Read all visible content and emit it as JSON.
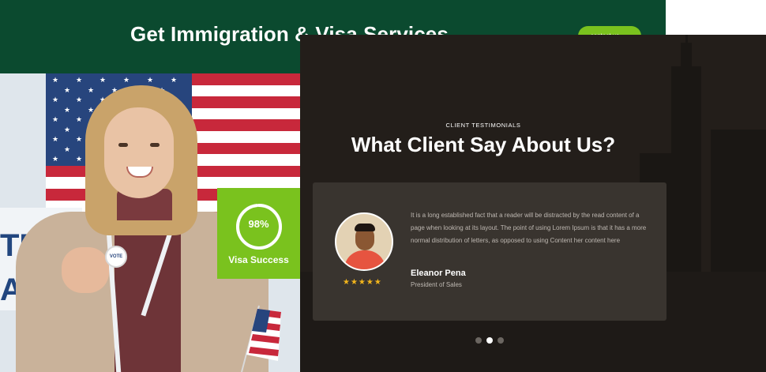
{
  "banner": {
    "title": "Get Immigration & Visa Services",
    "button_label": "contact us",
    "button_icon": "arrow-right-icon",
    "bg_color": "#0b4a2f",
    "accent_color": "#7ac21e"
  },
  "photo": {
    "sign_text": "TE\nAY",
    "badge_text": "VOTE"
  },
  "visa_card": {
    "percent_text": "98%",
    "percent_value": 0.98,
    "label": "Visa Success"
  },
  "testimonials": {
    "eyebrow": "CLIENT TESTIMONIALS",
    "heading": "What Client Say About Us?",
    "items": [
      {
        "quote": "It is a long established fact that a reader will be distracted by the read content of a page when looking at its layout. The point of using Lorem Ipsum is that it has a more normal distribution of letters, as opposed to using Content her content here",
        "name": "Eleanor Pena",
        "role": "President of Sales",
        "rating": 5,
        "stars": "★★★★★"
      }
    ],
    "pagination": {
      "count": 3,
      "active_index": 1
    }
  }
}
